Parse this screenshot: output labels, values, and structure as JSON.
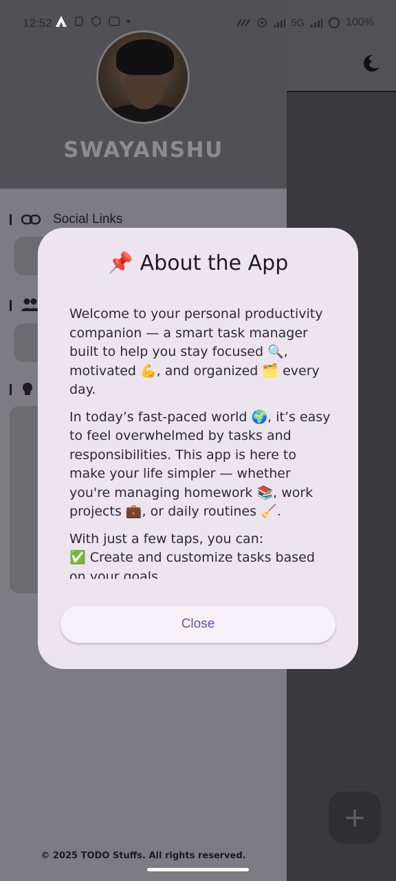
{
  "status_bar": {
    "time": "12:52",
    "network": "5G",
    "battery": "100%"
  },
  "drawer": {
    "profile_name": "SWAYANSHU",
    "sections": {
      "social_links": "Social Links"
    },
    "footer": "© 2025 TODO Stuffs. All rights reserved."
  },
  "dialog": {
    "title": "📌 About the App",
    "paragraphs": [
      "Welcome to your personal productivity companion — a smart task manager built to help you stay focused 🔍, motivated 💪, and organized 🗂️ every day.",
      "In today’s fast-paced world 🌍, it’s easy to feel overwhelmed by tasks and responsibilities. This app is here to make your life simpler — whether you're managing homework 📚, work projects 💼, or daily routines 🧹.",
      "With just a few taps, you can:\n✅ Create and customize tasks based on your goals"
    ],
    "close_label": "Close"
  },
  "fab": {
    "icon": "plus-icon"
  },
  "colors": {
    "dialog_bg": "#ece5ef",
    "accent": "#6b4fa6",
    "scrim": "#3a393d"
  }
}
